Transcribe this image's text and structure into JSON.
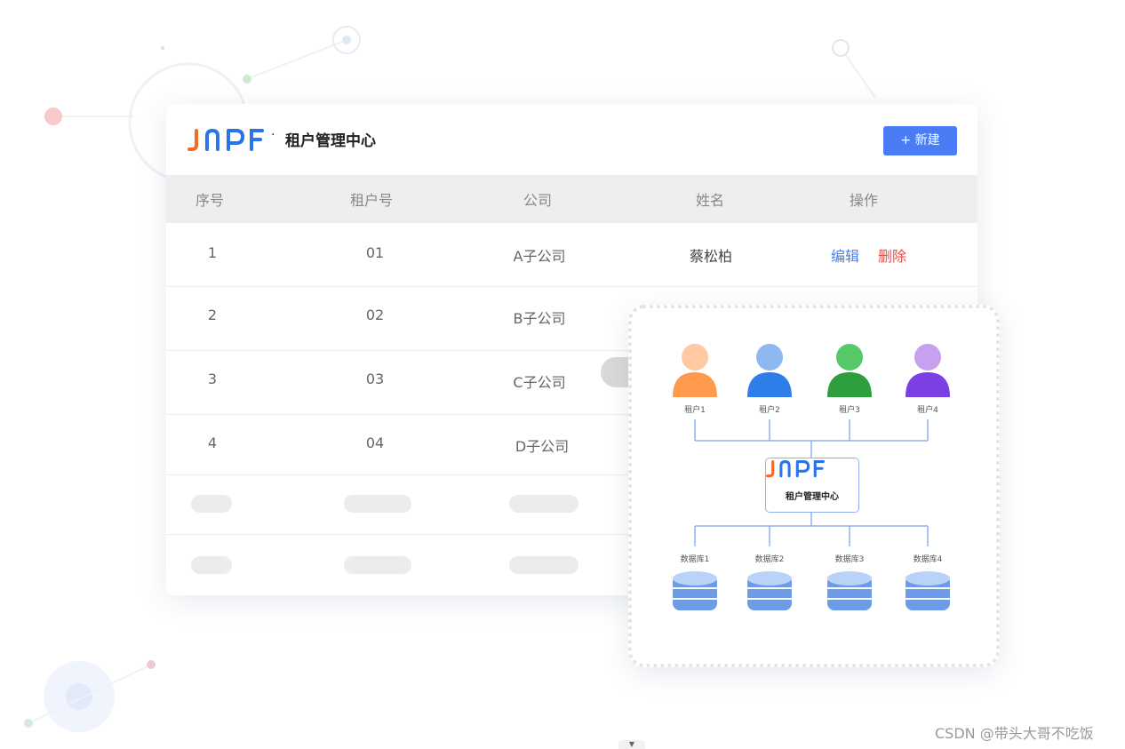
{
  "header": {
    "logo_text": "JNPF",
    "separator": "·",
    "title": "租户管理中心",
    "new_button": "+ 新建"
  },
  "table": {
    "columns": [
      "序号",
      "租户号",
      "公司",
      "姓名",
      "操作"
    ],
    "rows": [
      {
        "index": "1",
        "tenant_no": "01",
        "company": "A子公司",
        "name": "蔡松柏"
      },
      {
        "index": "2",
        "tenant_no": "02",
        "company": "B子公司",
        "name": ""
      },
      {
        "index": "3",
        "tenant_no": "03",
        "company": "C子公司",
        "name": ""
      },
      {
        "index": "4",
        "tenant_no": "04",
        "company": "D子公司",
        "name": ""
      }
    ],
    "actions": {
      "edit": "编辑",
      "delete": "删除"
    }
  },
  "diagram": {
    "tenants": [
      "租户1",
      "租户2",
      "租户3",
      "租户4"
    ],
    "tenant_colors": [
      "#ff9a4d",
      "#2e7de9",
      "#2e9e3e",
      "#7b3fe4"
    ],
    "center_logo": "JNPF",
    "center_title": "租户管理中心",
    "databases": [
      "数据库1",
      "数据库2",
      "数据库3",
      "数据库4"
    ]
  },
  "colors": {
    "accent": "#4a7cf6",
    "danger": "#ee4b4b",
    "logo_orange": "#f26b2a",
    "logo_blue": "#2a73e8"
  },
  "watermark": "CSDN @带头大哥不吃饭"
}
